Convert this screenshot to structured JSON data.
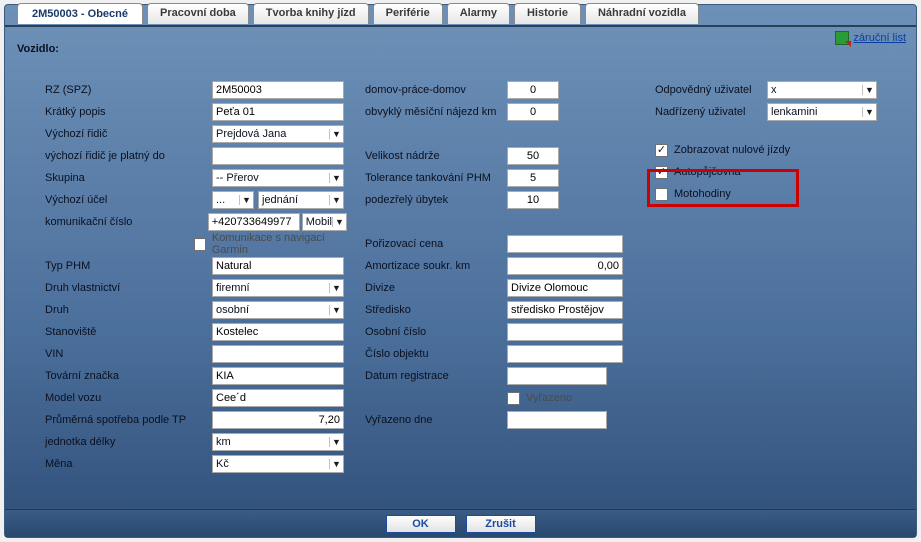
{
  "tabs": {
    "active": "2M50003 - Obecné",
    "items": [
      "Pracovní doba",
      "Tvorba knihy jízd",
      "Periférie",
      "Alarmy",
      "Historie",
      "Náhradní vozidla"
    ]
  },
  "right_link": "záruční list",
  "section_title": "Vozidlo:",
  "col1": {
    "rz_label": "RZ (SPZ)",
    "rz_value": "2M50003",
    "kratky_popis_label": "Krátký popis",
    "kratky_popis_value": "Peťa 01",
    "vychozi_ridic_label": "Výchozí řidič",
    "vychozi_ridic_value": "Prejdová Jana",
    "vychozi_ridic_platny_label": "výchozí řidič je platný do",
    "vychozi_ridic_platny_value": "",
    "skupina_label": "Skupina",
    "skupina_value": "-- Přerov",
    "vychozi_ucel_label": "Výchozí účel",
    "vychozi_ucel_short": "...",
    "vychozi_ucel_value": "jednání",
    "kom_cislo_label": "komunikační číslo",
    "kom_cislo_value": "+420733649977",
    "kom_cislo_typ": "Mobil",
    "garmin_label": "Komunikace s navigací Garmin",
    "garmin_checked": false,
    "typ_phm_label": "Typ PHM",
    "typ_phm_value": "Natural",
    "druh_vlast_label": "Druh vlastnictví",
    "druh_vlast_value": "firemní",
    "druh_label": "Druh",
    "druh_value": "osobní",
    "stanoviste_label": "Stanoviště",
    "stanoviste_value": "Kostelec",
    "vin_label": "VIN",
    "vin_value": "",
    "znacka_label": "Tovární značka",
    "znacka_value": "KIA",
    "model_label": "Model vozu",
    "model_value": "Cee´d",
    "spotreba_label": "Průměrná spotřeba podle TP",
    "spotreba_value": "7,20",
    "jednotka_label": "jednotka délky",
    "jednotka_value": "km",
    "mena_label": "Měna",
    "mena_value": "Kč"
  },
  "col2": {
    "dpd_label": "domov-práce-domov",
    "dpd_value": "0",
    "najezd_label": "obvyklý měsíční nájezd km",
    "najezd_value": "0",
    "nadrz_label": "Velikost nádrže",
    "nadrz_value": "50",
    "tolerance_label": "Tolerance tankování PHM",
    "tolerance_value": "5",
    "ubytek_label": "podezřelý úbytek",
    "ubytek_value": "10",
    "poriz_label": "Pořizovací cena",
    "poriz_value": "",
    "amort_label": "Amortizace soukr. km",
    "amort_value": "0,00",
    "divize_label": "Divize",
    "divize_value": "Divize Olomouc",
    "stredisko_label": "Středisko",
    "stredisko_value": "středisko Prostějov",
    "oscislo_label": "Osobní číslo",
    "oscislo_value": "",
    "objekt_label": "Číslo objektu",
    "objekt_value": "",
    "datum_reg_label": "Datum registrace",
    "datum_reg_value": "",
    "vyrazeno_check_label": "Vyřazeno",
    "vyrazeno_checked": false,
    "vyrazeno_dne_label": "Vyřazeno dne",
    "vyrazeno_dne_value": ""
  },
  "col3": {
    "odp_label": "Odpovědný uživatel",
    "odp_value": "x",
    "nad_label": "Nadřízený uživatel",
    "nad_value": "lenkamini",
    "cb_nulove_label": "Zobrazovat nulové jízdy",
    "cb_nulove": true,
    "cb_autopujcovna_label": "Autopůjčovna",
    "cb_autopujcovna": true,
    "cb_motohodiny_label": "Motohodiny",
    "cb_motohodiny": false
  },
  "footer": {
    "ok": "OK",
    "cancel": "Zrušit"
  }
}
